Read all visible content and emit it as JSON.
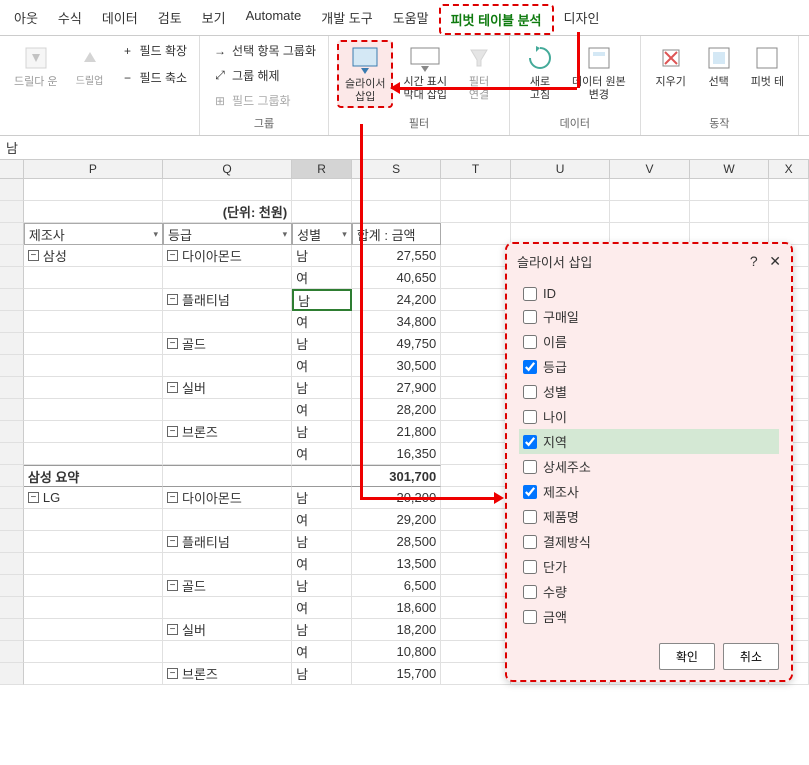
{
  "ribbon": {
    "tabs": [
      "아웃",
      "수식",
      "데이터",
      "검토",
      "보기",
      "Automate",
      "개발 도구",
      "도움말",
      "피벗 테이블 분석",
      "디자인"
    ],
    "active_tab_index": 8,
    "groups": {
      "drill": {
        "drilldown": "드릴다\n운",
        "drillup": "드릴업",
        "expand": "필드 확장",
        "collapse": "필드 축소"
      },
      "group": {
        "label": "그룹",
        "sel": "선택 항목 그룹화",
        "ungroup": "그룹 해제",
        "field": "필드 그룹화"
      },
      "filter": {
        "label": "필터",
        "slicer": "슬라이서\n삽입",
        "timeline": "시간 표시\n막대 삽입",
        "conn": "필터\n연결"
      },
      "data": {
        "label": "데이터",
        "refresh": "새로\n고침",
        "source": "데이터 원본\n변경"
      },
      "actions": {
        "label": "동작",
        "clear": "지우기",
        "select": "선택",
        "move": "피벗 테"
      }
    }
  },
  "formula_bar": {
    "value": "남"
  },
  "columns": [
    "P",
    "Q",
    "R",
    "S",
    "T",
    "U",
    "V",
    "W",
    "X"
  ],
  "unit_label": "(단위: 천원)",
  "pivot_headers": {
    "p": "제조사",
    "q": "등급",
    "r": "성별",
    "s": "합계 : 금액"
  },
  "pivot": {
    "makers": [
      {
        "name": "삼성",
        "grades": [
          {
            "name": "다이아몬드",
            "rows": [
              [
                "남",
                "27,550"
              ],
              [
                "여",
                "40,650"
              ]
            ]
          },
          {
            "name": "플래티넘",
            "rows": [
              [
                "남",
                "24,200"
              ],
              [
                "여",
                "34,800"
              ]
            ]
          },
          {
            "name": "골드",
            "rows": [
              [
                "남",
                "49,750"
              ],
              [
                "여",
                "30,500"
              ]
            ]
          },
          {
            "name": "실버",
            "rows": [
              [
                "남",
                "27,900"
              ],
              [
                "여",
                "28,200"
              ]
            ]
          },
          {
            "name": "브론즈",
            "rows": [
              [
                "남",
                "21,800"
              ],
              [
                "여",
                "16,350"
              ]
            ]
          }
        ],
        "subtotal_label": "삼성 요약",
        "subtotal": "301,700"
      },
      {
        "name": "LG",
        "grades": [
          {
            "name": "다이아몬드",
            "rows": [
              [
                "남",
                "20,200"
              ],
              [
                "여",
                "29,200"
              ]
            ]
          },
          {
            "name": "플래티넘",
            "rows": [
              [
                "남",
                "28,500"
              ],
              [
                "여",
                "13,500"
              ]
            ]
          },
          {
            "name": "골드",
            "rows": [
              [
                "남",
                "6,500"
              ],
              [
                "여",
                "18,600"
              ]
            ]
          },
          {
            "name": "실버",
            "rows": [
              [
                "남",
                "18,200"
              ],
              [
                "여",
                "10,800"
              ]
            ]
          },
          {
            "name": "브론즈",
            "rows": [
              [
                "남",
                "15,700"
              ]
            ]
          }
        ]
      }
    ]
  },
  "dialog": {
    "title": "슬라이서 삽입",
    "fields": [
      {
        "label": "ID",
        "checked": false
      },
      {
        "label": "구매일",
        "checked": false
      },
      {
        "label": "이름",
        "checked": false
      },
      {
        "label": "등급",
        "checked": true
      },
      {
        "label": "성별",
        "checked": false
      },
      {
        "label": "나이",
        "checked": false
      },
      {
        "label": "지역",
        "checked": true,
        "selected": true
      },
      {
        "label": "상세주소",
        "checked": false
      },
      {
        "label": "제조사",
        "checked": true
      },
      {
        "label": "제품명",
        "checked": false
      },
      {
        "label": "결제방식",
        "checked": false
      },
      {
        "label": "단가",
        "checked": false
      },
      {
        "label": "수량",
        "checked": false
      },
      {
        "label": "금액",
        "checked": false
      }
    ],
    "ok": "확인",
    "cancel": "취소"
  }
}
